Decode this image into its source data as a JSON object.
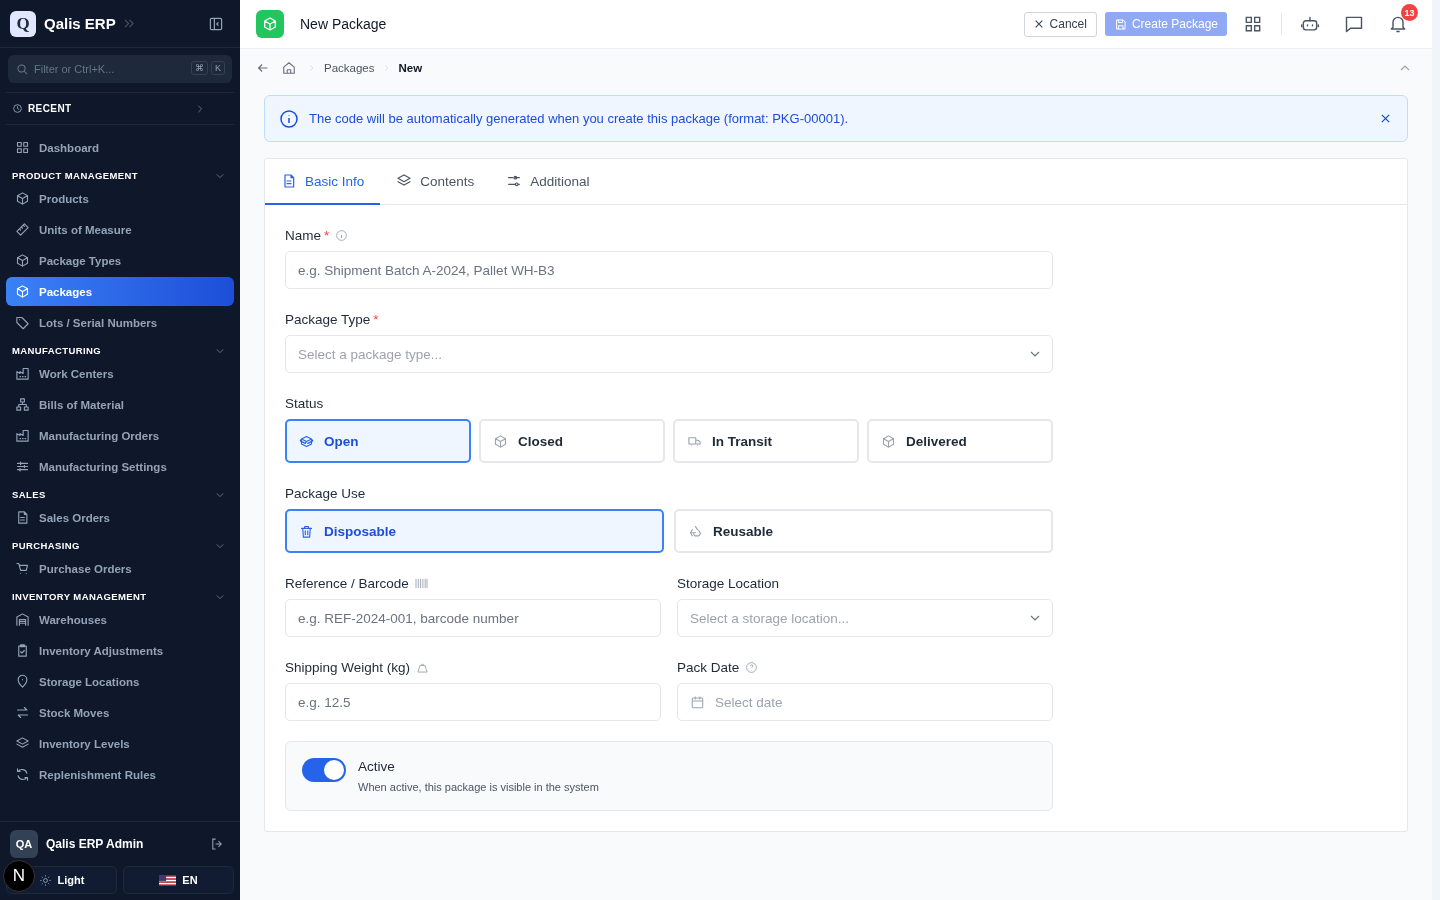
{
  "sidebar": {
    "brand": {
      "logo_letter": "Q",
      "name": "Qalis ERP"
    },
    "search": {
      "placeholder": "Filter or Ctrl+K...",
      "shortcut_keys": [
        "⌘",
        "K"
      ]
    },
    "recent": "RECENT",
    "top_items": [
      {
        "label": "Dashboard",
        "selected": false
      }
    ],
    "groups": [
      {
        "title": "PRODUCT MANAGEMENT",
        "expanded": true,
        "items": [
          {
            "label": "Products",
            "selected": false
          },
          {
            "label": "Units of Measure",
            "selected": false
          },
          {
            "label": "Package Types",
            "selected": false
          },
          {
            "label": "Packages",
            "selected": true
          },
          {
            "label": "Lots / Serial Numbers",
            "selected": false
          }
        ]
      },
      {
        "title": "MANUFACTURING",
        "expanded": true,
        "items": [
          {
            "label": "Work Centers",
            "selected": false
          },
          {
            "label": "Bills of Material",
            "selected": false
          },
          {
            "label": "Manufacturing Orders",
            "selected": false
          },
          {
            "label": "Manufacturing Settings",
            "selected": false
          }
        ]
      },
      {
        "title": "SALES",
        "expanded": true,
        "items": [
          {
            "label": "Sales Orders",
            "selected": false
          }
        ]
      },
      {
        "title": "PURCHASING",
        "expanded": true,
        "items": [
          {
            "label": "Purchase Orders",
            "selected": false
          }
        ]
      },
      {
        "title": "INVENTORY MANAGEMENT",
        "expanded": true,
        "items": [
          {
            "label": "Warehouses",
            "selected": false
          },
          {
            "label": "Inventory Adjustments",
            "selected": false
          },
          {
            "label": "Storage Locations",
            "selected": false
          },
          {
            "label": "Stock Moves",
            "selected": false
          },
          {
            "label": "Inventory Levels",
            "selected": false
          },
          {
            "label": "Replenishment Rules",
            "selected": false
          }
        ]
      }
    ],
    "user": {
      "initials": "QA",
      "name": "Qalis ERP Admin"
    },
    "theme_button": "Light",
    "language_button": "EN"
  },
  "dev_badge": "N",
  "header": {
    "title": "New Package",
    "cancel": "Cancel",
    "create": {
      "label": "Create Package",
      "disabled": true
    },
    "notification_count": "13"
  },
  "breadcrumb": [
    "Packages",
    "New"
  ],
  "alert": {
    "message": "The code will be automatically generated when you create this package (format: PKG-00001)."
  },
  "tabs": [
    {
      "label": "Basic Info",
      "selected": true
    },
    {
      "label": "Contents",
      "selected": false
    },
    {
      "label": "Additional",
      "selected": false
    }
  ],
  "form": {
    "name": {
      "label": "Name",
      "required_mark": "*",
      "placeholder": "e.g. Shipment Batch A-2024, Pallet WH-B3"
    },
    "package_type": {
      "label": "Package Type",
      "required_mark": "*",
      "placeholder": "Select a package type..."
    },
    "status": {
      "label": "Status",
      "options": [
        {
          "label": "Open",
          "selected": true
        },
        {
          "label": "Closed",
          "selected": false
        },
        {
          "label": "In Transit",
          "selected": false
        },
        {
          "label": "Delivered",
          "selected": false
        }
      ]
    },
    "package_use": {
      "label": "Package Use",
      "options": [
        {
          "label": "Disposable",
          "selected": true
        },
        {
          "label": "Reusable",
          "selected": false
        }
      ]
    },
    "reference": {
      "label": "Reference / Barcode",
      "placeholder": "e.g. REF-2024-001, barcode number"
    },
    "storage_location": {
      "label": "Storage Location",
      "placeholder": "Select a storage location..."
    },
    "shipping_weight": {
      "label": "Shipping Weight (kg)",
      "placeholder": "e.g. 12.5"
    },
    "pack_date": {
      "label": "Pack Date",
      "placeholder": "Select date"
    },
    "active": {
      "label": "Active",
      "description": "When active, this package is visible in the system",
      "on": true
    }
  }
}
